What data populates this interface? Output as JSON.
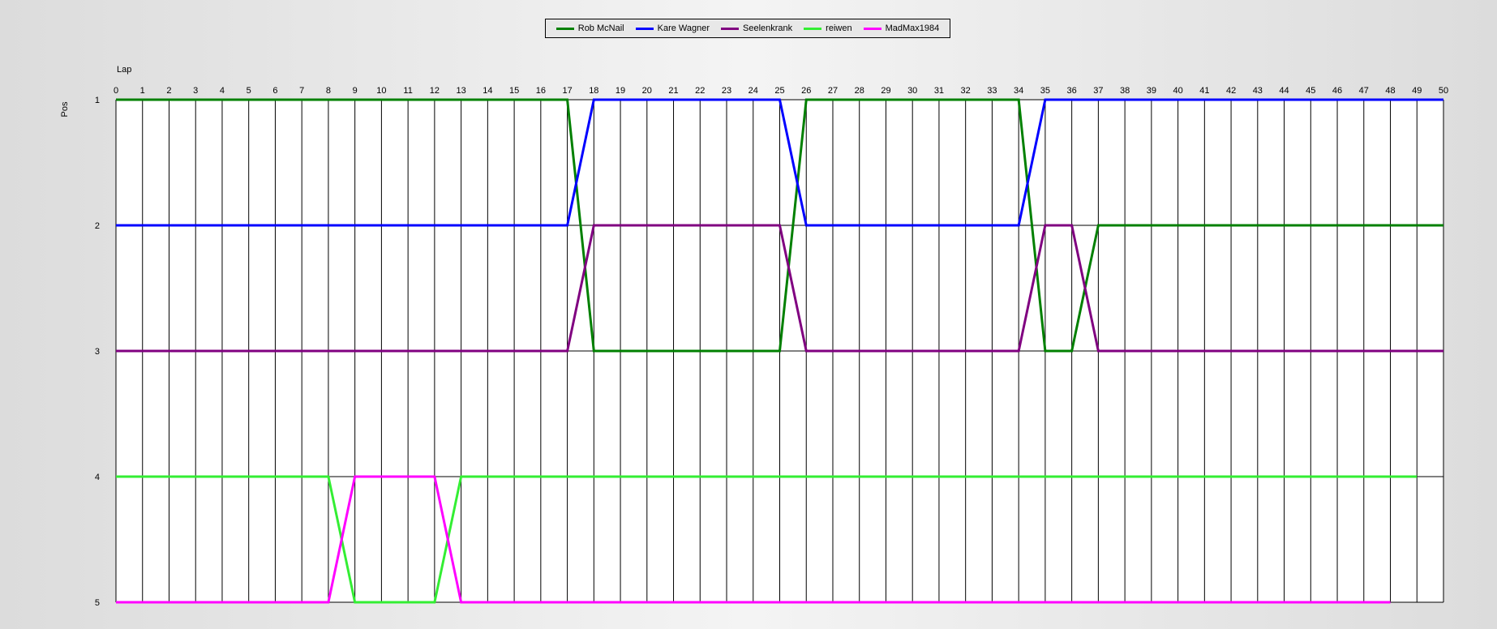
{
  "chart_data": {
    "type": "line",
    "xlabel": "Lap",
    "ylabel": "Pos",
    "xlim": [
      0,
      50
    ],
    "ylim": [
      1,
      5
    ],
    "y_inverted": true,
    "legend_position": "top-center",
    "x": [
      0,
      1,
      2,
      3,
      4,
      5,
      6,
      7,
      8,
      9,
      10,
      11,
      12,
      13,
      14,
      15,
      16,
      17,
      18,
      19,
      20,
      21,
      22,
      23,
      24,
      25,
      26,
      27,
      28,
      29,
      30,
      31,
      32,
      33,
      34,
      35,
      36,
      37,
      38,
      39,
      40,
      41,
      42,
      43,
      44,
      45,
      46,
      47,
      48,
      49,
      50
    ],
    "y_ticks": [
      1,
      2,
      3,
      4,
      5
    ],
    "series": [
      {
        "name": "Rob McNail",
        "color": "#008000",
        "values": [
          1,
          1,
          1,
          1,
          1,
          1,
          1,
          1,
          1,
          1,
          1,
          1,
          1,
          1,
          1,
          1,
          1,
          1,
          3,
          3,
          3,
          3,
          3,
          3,
          3,
          3,
          1,
          1,
          1,
          1,
          1,
          1,
          1,
          1,
          1,
          3,
          3,
          2,
          2,
          2,
          2,
          2,
          2,
          2,
          2,
          2,
          2,
          2,
          2,
          2,
          2
        ]
      },
      {
        "name": "Kare Wagner",
        "color": "#0000ff",
        "values": [
          2,
          2,
          2,
          2,
          2,
          2,
          2,
          2,
          2,
          2,
          2,
          2,
          2,
          2,
          2,
          2,
          2,
          2,
          1,
          1,
          1,
          1,
          1,
          1,
          1,
          1,
          2,
          2,
          2,
          2,
          2,
          2,
          2,
          2,
          2,
          1,
          1,
          1,
          1,
          1,
          1,
          1,
          1,
          1,
          1,
          1,
          1,
          1,
          1,
          1,
          1
        ]
      },
      {
        "name": "Seelenkrank",
        "color": "#800080",
        "values": [
          3,
          3,
          3,
          3,
          3,
          3,
          3,
          3,
          3,
          3,
          3,
          3,
          3,
          3,
          3,
          3,
          3,
          3,
          2,
          2,
          2,
          2,
          2,
          2,
          2,
          2,
          3,
          3,
          3,
          3,
          3,
          3,
          3,
          3,
          3,
          2,
          2,
          3,
          3,
          3,
          3,
          3,
          3,
          3,
          3,
          3,
          3,
          3,
          3,
          3,
          3
        ]
      },
      {
        "name": "reiwen",
        "color": "#33ee33",
        "values": [
          4,
          4,
          4,
          4,
          4,
          4,
          4,
          4,
          4,
          5,
          5,
          5,
          5,
          4,
          4,
          4,
          4,
          4,
          4,
          4,
          4,
          4,
          4,
          4,
          4,
          4,
          4,
          4,
          4,
          4,
          4,
          4,
          4,
          4,
          4,
          4,
          4,
          4,
          4,
          4,
          4,
          4,
          4,
          4,
          4,
          4,
          4,
          4,
          4,
          4
        ]
      },
      {
        "name": "MadMax1984",
        "color": "#ff00ff",
        "values": [
          5,
          5,
          5,
          5,
          5,
          5,
          5,
          5,
          5,
          4,
          4,
          4,
          4,
          5,
          5,
          5,
          5,
          5,
          5,
          5,
          5,
          5,
          5,
          5,
          5,
          5,
          5,
          5,
          5,
          5,
          5,
          5,
          5,
          5,
          5,
          5,
          5,
          5,
          5,
          5,
          5,
          5,
          5,
          5,
          5,
          5,
          5,
          5,
          5
        ]
      }
    ]
  }
}
